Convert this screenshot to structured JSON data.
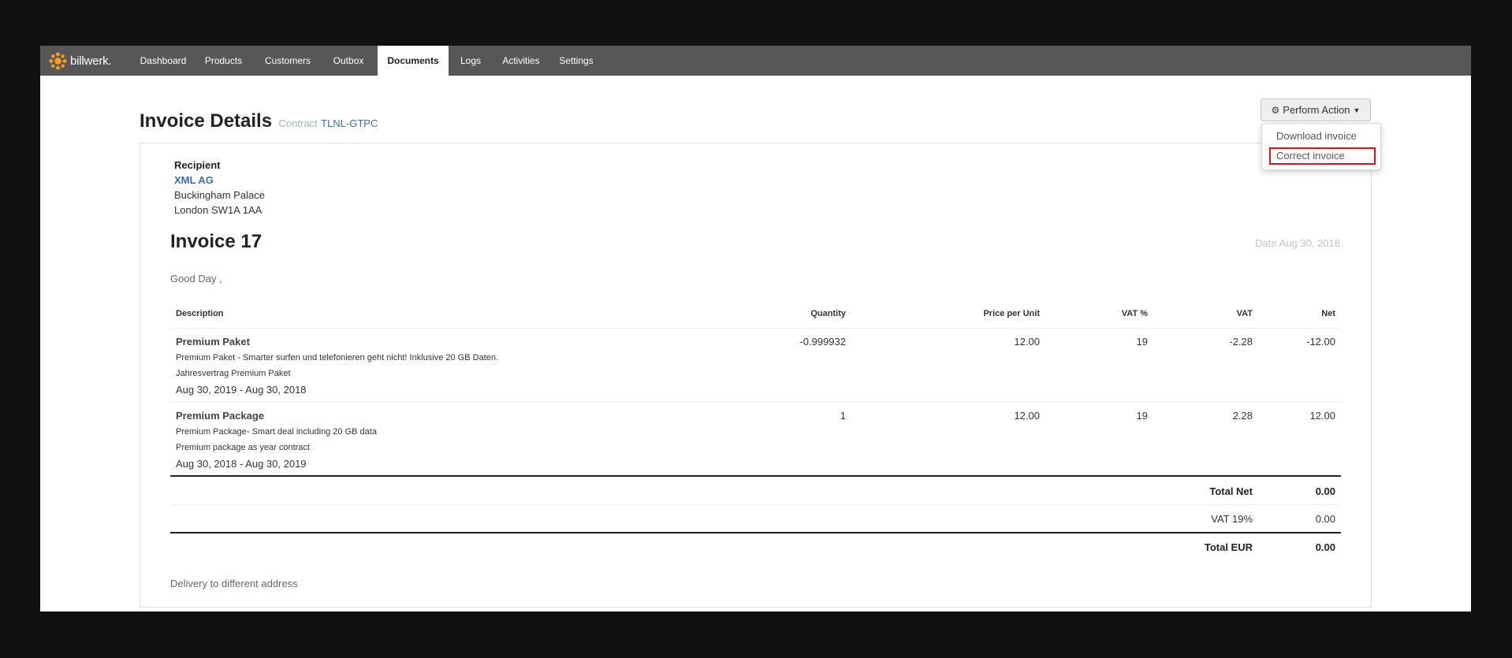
{
  "app": {
    "brand": "billwerk.",
    "nav": [
      "Dashboard",
      "Products",
      "Customers",
      "Outbox",
      "Documents",
      "Logs",
      "Activities",
      "Settings"
    ],
    "active_nav": "Documents"
  },
  "header": {
    "title": "Invoice Details",
    "contract_label": "Contract",
    "contract_id": "TLNL-GTPC"
  },
  "actions": {
    "button_label": "Perform Action",
    "menu": [
      "Download invoice",
      "Correct invoice"
    ],
    "highlighted": "Correct invoice"
  },
  "recipient": {
    "label": "Recipient",
    "name": "XML AG",
    "street": "Buckingham Palace",
    "city": "London SW1A 1AA"
  },
  "invoice": {
    "title": "Invoice 17",
    "date": "Date Aug 30, 2018",
    "greeting": "Good Day ,",
    "columns": [
      "Description",
      "Quantity",
      "Price per Unit",
      "VAT %",
      "VAT",
      "Net"
    ],
    "items": [
      {
        "name": "Premium Paket",
        "desc1": "Premium Paket - Smarter surfen und telefonieren geht nicht! Inklusive 20 GB Daten.",
        "desc2": "Jahresvertrag Premium Paket",
        "period": "Aug 30, 2019 - Aug 30, 2018",
        "quantity": "-0.999932",
        "price": "12.00",
        "vat_pct": "19",
        "vat": "-2.28",
        "net": "-12.00"
      },
      {
        "name": "Premium Package",
        "desc1": "Premium Package- Smart deal including 20 GB data",
        "desc2": "Premium package as year contract",
        "period": "Aug 30, 2018 - Aug 30, 2019",
        "quantity": "1",
        "price": "12.00",
        "vat_pct": "19",
        "vat": "2.28",
        "net": "12.00"
      }
    ],
    "totals": {
      "net_label": "Total Net",
      "net_value": "0.00",
      "vat_label": "VAT 19%",
      "vat_value": "0.00",
      "total_label": "Total EUR",
      "total_value": "0.00"
    },
    "footer_note": "Delivery to different address"
  },
  "colors": {
    "nav_bg": "#575757",
    "link": "#3a6da1",
    "highlight": "#d9141d",
    "brand_orange": "#f39a2b"
  },
  "icons": {
    "brand": "billwerk-logo-icon",
    "gear": "gear-icon",
    "caret": "caret-down-icon"
  }
}
